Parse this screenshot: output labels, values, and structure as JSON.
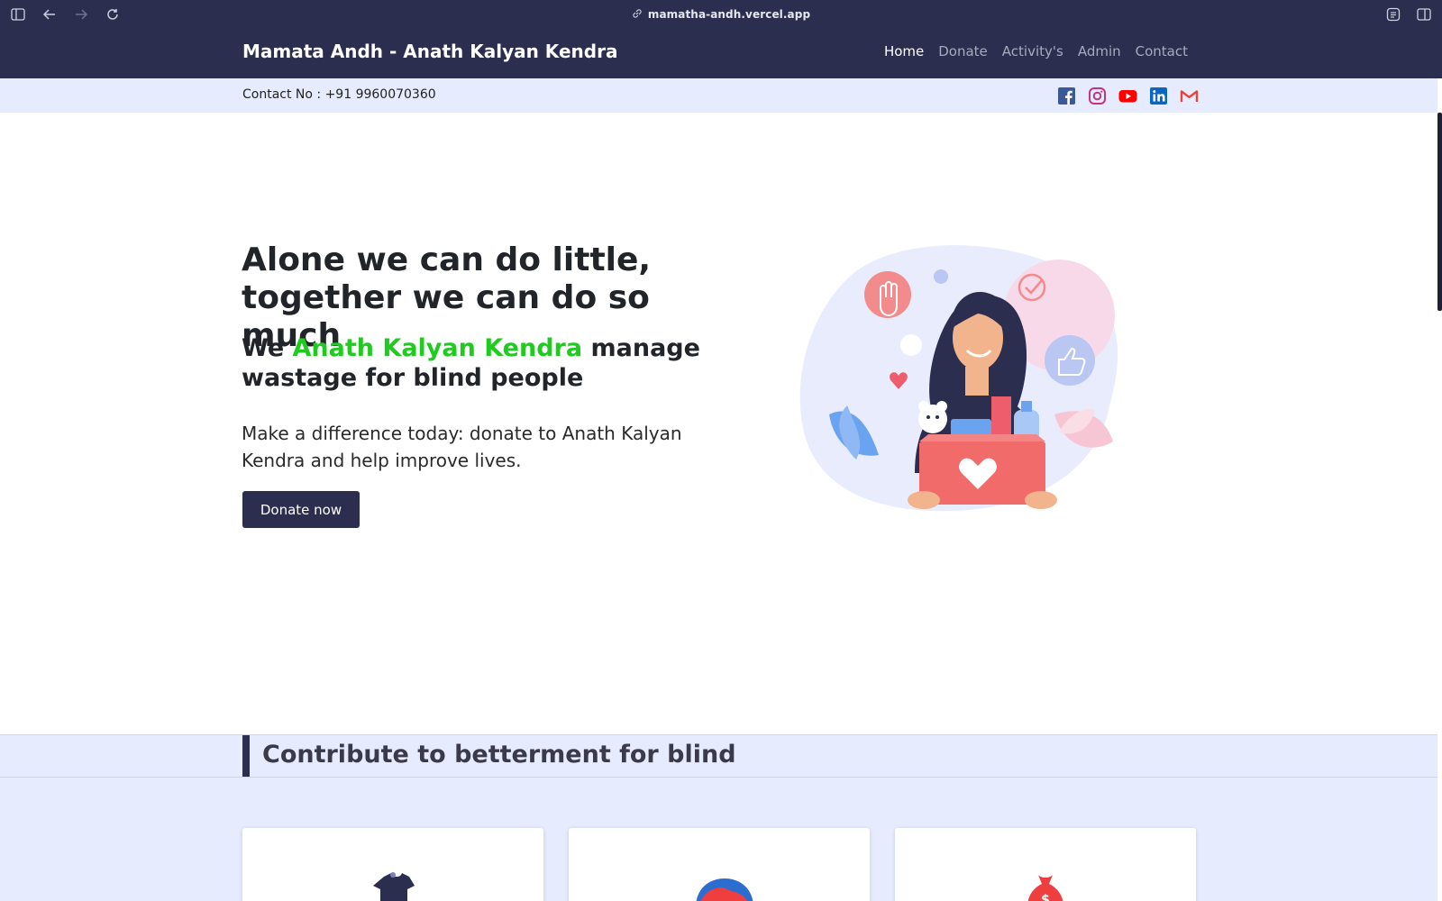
{
  "browser": {
    "url": "mamatha-andh.vercel.app",
    "icons": [
      "sidebar-icon",
      "back-icon",
      "forward-icon",
      "reload-icon",
      "link-icon",
      "reader-icon",
      "split-view-icon"
    ]
  },
  "navbar": {
    "brand": "Mamata Andh - Anath Kalyan Kendra",
    "links": [
      {
        "label": "Home",
        "active": true
      },
      {
        "label": "Donate",
        "active": false
      },
      {
        "label": "Activity's",
        "active": false
      },
      {
        "label": "Admin",
        "active": false
      },
      {
        "label": "Contact",
        "active": false
      }
    ]
  },
  "contact_bar": {
    "contact": "Contact No : +91 9960070360",
    "social_icons": [
      "facebook-icon",
      "instagram-icon",
      "youtube-icon",
      "linkedin-icon",
      "gmail-icon"
    ]
  },
  "hero": {
    "headline": "Alone we can do little, together we can do so much",
    "subhead_prefix": "We ",
    "subhead_highlight": "Anath Kalyan Kendra",
    "subhead_suffix": " manage wastage for blind people",
    "description": "Make a difference today: donate to Anath Kalyan Kendra and help improve lives.",
    "cta": "Donate now"
  },
  "section": {
    "title": "Contribute to betterment for blind"
  },
  "cards": [
    {
      "icon": "tshirt-icon"
    },
    {
      "icon": "shoe-icon"
    },
    {
      "icon": "money-bag-icon"
    }
  ],
  "colors": {
    "navbar": "#2c2e4f",
    "contact_bar": "#e6ecfd",
    "highlight_green": "#1ecb1e",
    "button": "#2c2e4f"
  }
}
